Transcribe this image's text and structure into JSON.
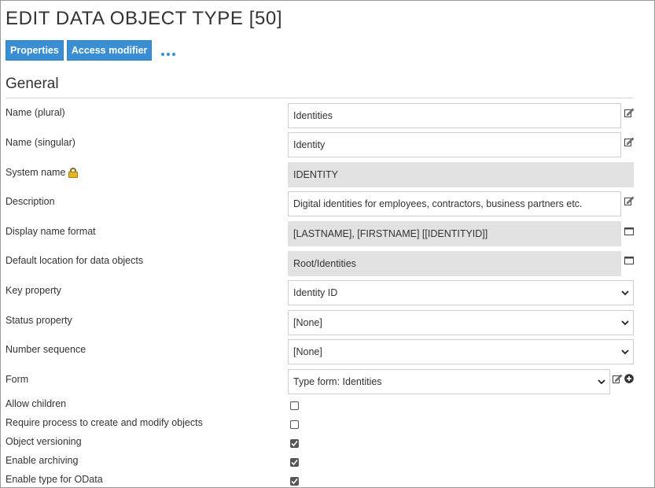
{
  "page": {
    "title": "EDIT DATA OBJECT TYPE [50]"
  },
  "tabs": [
    {
      "label": "Properties"
    },
    {
      "label": "Access modifier"
    }
  ],
  "more_icon": "ellipsis-icon",
  "section": {
    "title": "General"
  },
  "fields": {
    "name_plural": {
      "label": "Name (plural)",
      "value": "Identities"
    },
    "name_singular": {
      "label": "Name (singular)",
      "value": "Identity"
    },
    "system_name": {
      "label": "System name",
      "value": "IDENTITY"
    },
    "description": {
      "label": "Description",
      "value": "Digital identities for employees, contractors, business partners etc."
    },
    "display_name_format": {
      "label": "Display name format",
      "value": "[LASTNAME], [FIRSTNAME] [[IDENTITYID]]"
    },
    "default_location": {
      "label": "Default location for data objects",
      "value": "Root/Identities"
    },
    "key_property": {
      "label": "Key property",
      "value": "Identity ID"
    },
    "status_property": {
      "label": "Status property",
      "value": "[None]"
    },
    "number_sequence": {
      "label": "Number sequence",
      "value": "[None]"
    },
    "form": {
      "label": "Form",
      "value": "Type form: Identities"
    }
  },
  "checkboxes": {
    "allow_children": {
      "label": "Allow children",
      "checked": false
    },
    "require_process": {
      "label": "Require process to create and modify objects",
      "checked": false
    },
    "object_versioning": {
      "label": "Object versioning",
      "checked": true
    },
    "enable_archiving": {
      "label": "Enable archiving",
      "checked": true
    },
    "enable_odata": {
      "label": "Enable type for OData",
      "checked": true
    }
  },
  "colors": {
    "accent": "#3a8fd4",
    "readonly_bg": "#e2e2e2",
    "text": "#333333"
  }
}
